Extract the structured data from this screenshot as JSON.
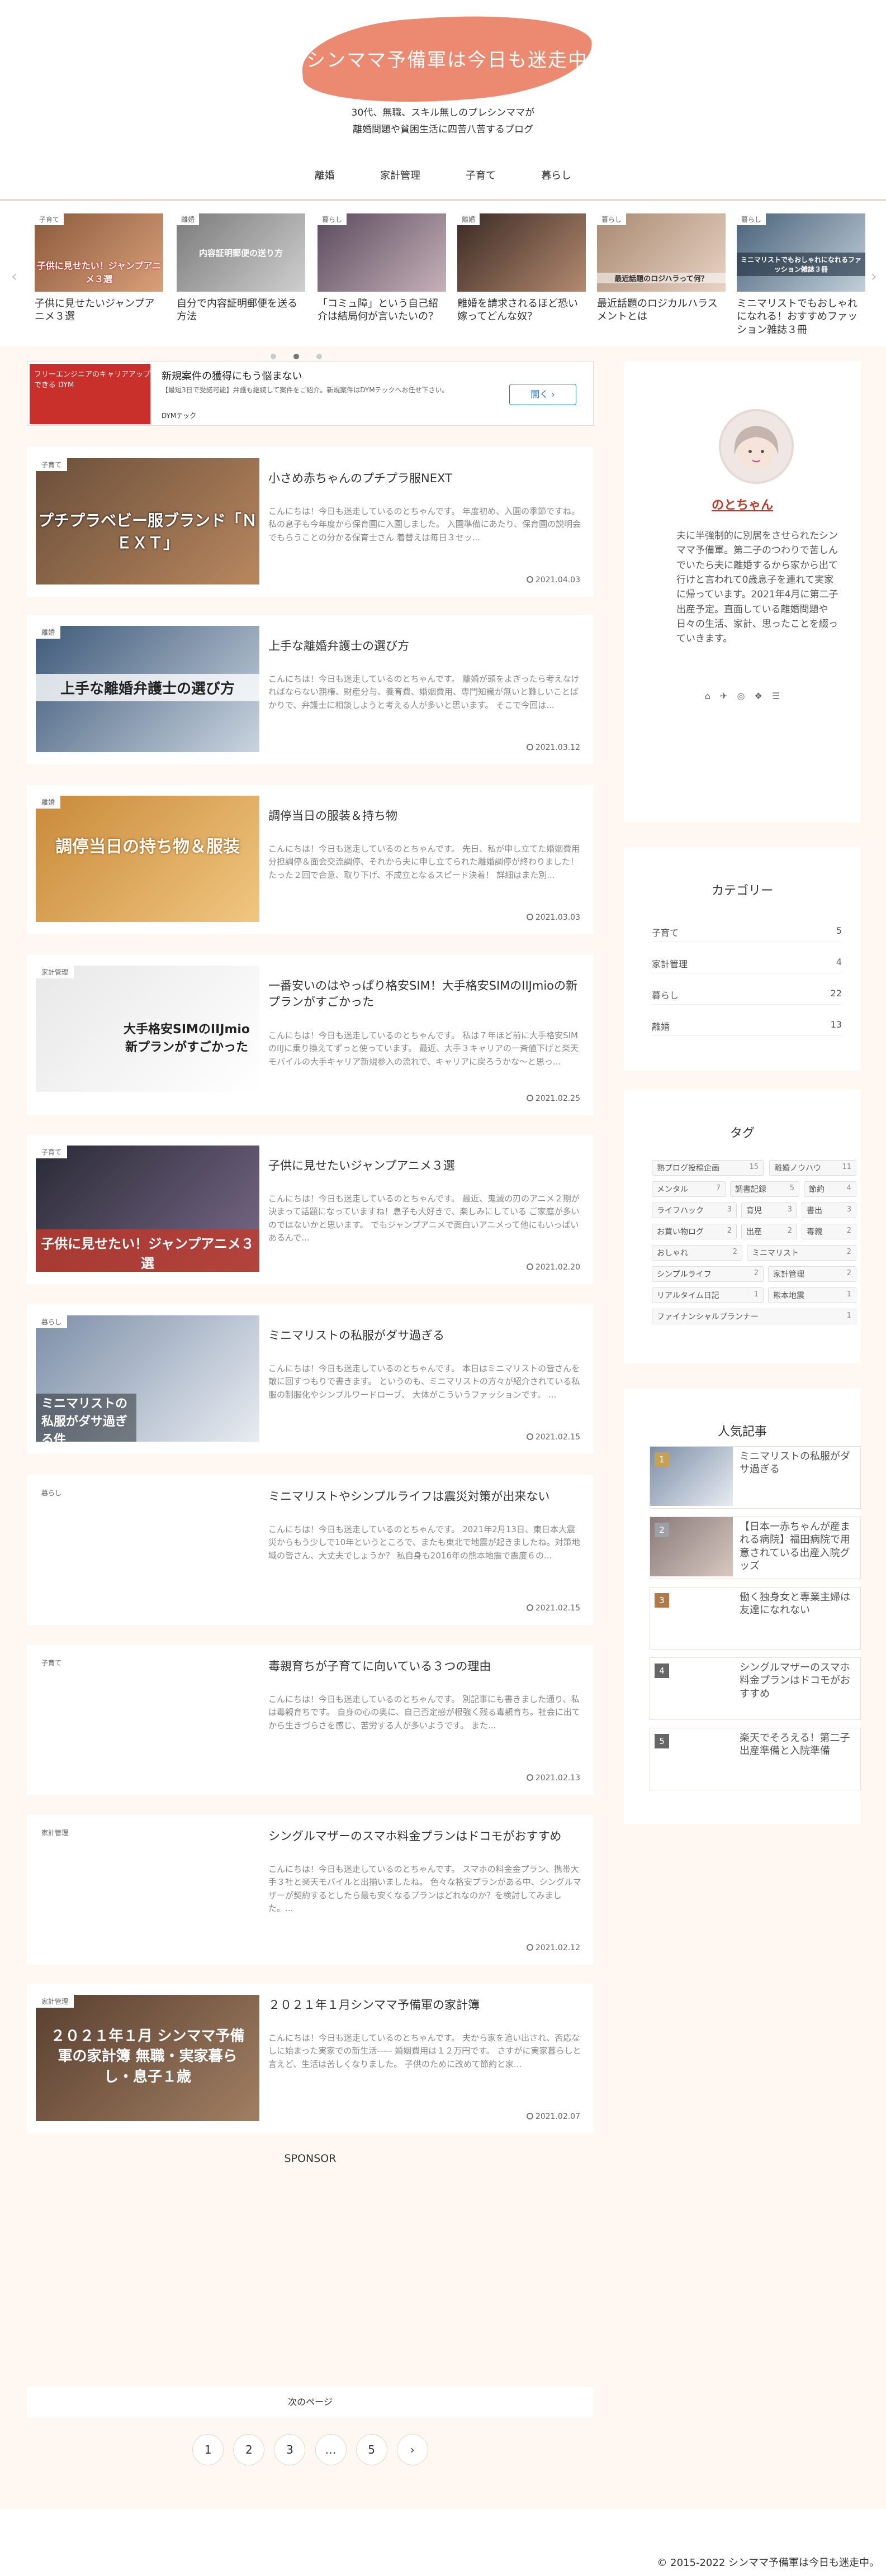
{
  "site": {
    "title": "シンママ予備軍は今日も迷走中",
    "tagline_1": "30代、無職、スキル無しのプレシンママが",
    "tagline_2": "離婚問題や貧困生活に四苦八苦するブログ"
  },
  "nav": [
    "離婚",
    "家計管理",
    "子育て",
    "暮らし"
  ],
  "carousel": [
    {
      "cat": "子育て",
      "title": "子供に見せたいジャンプアニメ３選",
      "thumb_text": "子供に見せたい！ジャンプアニメ３選"
    },
    {
      "cat": "離婚",
      "title": "自分で内容証明郵便を送る方法",
      "thumb_text": "内容証明郵便の送り方"
    },
    {
      "cat": "暮らし",
      "title": "「コミュ障」という自己紹介は結局何が言いたいの？",
      "thumb_text": ""
    },
    {
      "cat": "離婚",
      "title": "離婚を請求されるほど恐い嫁ってどんな奴？",
      "thumb_text": ""
    },
    {
      "cat": "暮らし",
      "title": "最近話題のロジカルハラスメントとは",
      "thumb_text": "最近話題のロジハラって何？"
    },
    {
      "cat": "暮らし",
      "title": "ミニマリストでもおしゃれになれる！おすすめファッション雑誌３冊",
      "thumb_text": "ミニマリストでもおしゃれになれるファッション雑誌３冊"
    }
  ],
  "ad": {
    "img_text": "フリーエンジニアのキャリアアップできる DYM",
    "title": "新規案件の獲得にもう悩まない",
    "desc": "【最短3日で受諾可能】弁護も継続して案件をご紹介。新規案件はDYMテックへお任せ下さい。",
    "source": "DYMテック",
    "button": "開く"
  },
  "posts": [
    {
      "cat": "子育て",
      "title": "小さめ赤ちゃんのプチプラ服NEXT",
      "excerpt": "こんにちは！今日も迷走しているのとちゃんです。 年度初め、入園の季節ですね。私の息子も今年度から保育園に入園しました。 入園準備にあたり、保育園の説明会でもらうことの分かる保育士さん 着替えは毎日３セッ...",
      "date": "2021.04.03",
      "thumb_text": "プチプラベビー服ブランド「ＮＥＸＴ」"
    },
    {
      "cat": "離婚",
      "title": "上手な離婚弁護士の選び方",
      "excerpt": "こんにちは！今日も迷走しているのとちゃんです。 離婚が頭をよぎったら考えなければならない親権、財産分与、養育費、婚姻費用、専門知識が無いと難しいことばかりで、弁護士に相談しようと考える人が多いと思います。 そこで今回は...",
      "date": "2021.03.12",
      "thumb_text": "上手な離婚弁護士の選び方"
    },
    {
      "cat": "離婚",
      "title": "調停当日の服装＆持ち物",
      "excerpt": "こんにちは！今日も迷走しているのとちゃんです。 先日、私が申し立てた婚姻費用分担調停＆面会交流調停、それから夫に申し立てられた離婚調停が終わりました！ たった２回で合意、取り下げ、不成立となるスピード決着！ 詳細はまた別...",
      "date": "2021.03.03",
      "thumb_text": "調停当日の持ち物＆服装"
    },
    {
      "cat": "家計管理",
      "title": "一番安いのはやっぱり格安SIM！大手格安SIMのIIJmioの新プランがすごかった",
      "excerpt": "こんにちは！今日も迷走しているのとちゃんです。 私は７年ほど前に大手格安SIMのIIJに乗り換えてずっと使っています。 最近、大手３キャリアの一斉値下げと楽天モバイルの大手キャリア新規参入の流れで、キャリアに戻ろうかな〜と思っ...",
      "date": "2021.02.25",
      "thumb_text": "大手格安SIMのIIJmio新プランがすごかった"
    },
    {
      "cat": "子育て",
      "title": "子供に見せたいジャンプアニメ３選",
      "excerpt": "こんにちは！今日も迷走しているのとちゃんです。 最近、鬼滅の刃のアニメ２期が決まって話題になっていますね！息子も大好きで、楽しみにしている ご家庭が多いのではないかと思います。 でもジャンプアニメで面白いアニメって他にもいっぱいあるんで...",
      "date": "2021.02.20",
      "thumb_text": "子供に見せたい！ジャンプアニメ３選"
    },
    {
      "cat": "暮らし",
      "title": "ミニマリストの私服がダサ過ぎる",
      "excerpt": "こんにちは！今日も迷走しているのとちゃんです。 本日はミニマリストの皆さんを敵に回すつもりで書きます。 というのも、ミニマリストの方々が紹介されている私服の制服化やシンプルワードローブ、 大体がこういうファッションです。 ...",
      "date": "2021.02.15",
      "thumb_text": "ミニマリストの私服がダサ過ぎる件"
    },
    {
      "cat": "暮らし",
      "title": "ミニマリストやシンプルライフは震災対策が出来ない",
      "excerpt": "こんにちは！今日も迷走しているのとちゃんです。 2021年2月13日、東日本大震災からもう少しで10年というところで、またも東北で地震が起きましたね。対策地域の皆さん、大丈夫でしょうか？ 私自身も2016年の熊本地震で震度６の...",
      "date": "2021.02.15",
      "thumb_text": ""
    },
    {
      "cat": "子育て",
      "title": "毒親育ちが子育てに向いている３つの理由",
      "excerpt": "こんにちは！今日も迷走しているのとちゃんです。 別記事にも書きました通り、私は毒親育ちです。 自身の心の奥に、自己否定感が根強く残る毒親育ち。社会に出てから生きづらさを感じ、苦労する人が多いようです。 また...",
      "date": "2021.02.13",
      "thumb_text": ""
    },
    {
      "cat": "家計管理",
      "title": "シングルマザーのスマホ料金プランはドコモがおすすめ",
      "excerpt": "こんにちは！今日も迷走しているのとちゃんです。 スマホの料金金プラン、携帯大手３社と楽天モバイルと出揃いましたね。 色々な格安プランがある中、シングルマザーが契約するとしたら最も安くなるプランはどれなのか？を検討してみました。...",
      "date": "2021.02.12",
      "thumb_text": ""
    },
    {
      "cat": "家計管理",
      "title": "２０２１年１月シンママ予備軍の家計簿",
      "excerpt": "こんにちは！今日も迷走しているのとちゃんです。 夫から家を追い出され、否応なしに始まった実家での新生活----- 婚姻費用は１２万円です。 さすがに実家暮らしと言えど、生活は苦しくなりました。 子供のために改めて節約と家...",
      "date": "2021.02.07",
      "thumb_text": "２０２１年１月 シンママ予備軍の家計簿 無職・実家暮らし・息子１歳"
    }
  ],
  "sponsor": "SPONSOR",
  "next_page": "次のページ",
  "pager": [
    "1",
    "2",
    "3",
    "…",
    "5",
    "›"
  ],
  "profile": {
    "name": "のとちゃん",
    "bio": "夫に半強制的に別居をさせられたシンママ予備軍。第二子のつわりで苦しんでいたら夫に離婚するから家から出て行けと言われて0歳息子を連れて実家に帰っています。2021年4月に第二子出産予定。直面している離婚問題や日々の生活、家計、思ったことを綴っていきます。",
    "social": [
      "⌂",
      "✈",
      "◎",
      "❖",
      "☰"
    ]
  },
  "categories": {
    "title": "カテゴリー",
    "items": [
      {
        "name": "子育て",
        "count": "5"
      },
      {
        "name": "家計管理",
        "count": "4"
      },
      {
        "name": "暮らし",
        "count": "22"
      },
      {
        "name": "離婚",
        "count": "13"
      }
    ]
  },
  "tags": {
    "title": "タグ",
    "items": [
      {
        "name": "熟プログ投稿企画",
        "count": "15"
      },
      {
        "name": "離婚ノウハウ",
        "count": "11"
      },
      {
        "name": "メンタル",
        "count": "7"
      },
      {
        "name": "調書記録",
        "count": "5"
      },
      {
        "name": "節約",
        "count": "4"
      },
      {
        "name": "ライフハック",
        "count": "3"
      },
      {
        "name": "育児",
        "count": "3"
      },
      {
        "name": "書出",
        "count": "3"
      },
      {
        "name": "お買い物ログ",
        "count": "2"
      },
      {
        "name": "出産",
        "count": "2"
      },
      {
        "name": "毒親",
        "count": "2"
      },
      {
        "name": "おしゃれ",
        "count": "2"
      },
      {
        "name": "ミニマリスト",
        "count": "2"
      },
      {
        "name": "シンプルライフ",
        "count": "2"
      },
      {
        "name": "家計管理",
        "count": "2"
      },
      {
        "name": "リアルタイム日記",
        "count": "1"
      },
      {
        "name": "熊本地震",
        "count": "1"
      },
      {
        "name": "ファイナンシャルプランナー",
        "count": "1"
      }
    ]
  },
  "popular": {
    "title": "人気記事",
    "items": [
      {
        "rank": "1",
        "title": "ミニマリストの私服がダサ過ぎる"
      },
      {
        "rank": "2",
        "title": "【日本一赤ちゃんが産まれる病院】福田病院で用意されている出産入院グッズ"
      },
      {
        "rank": "3",
        "title": "働く独身女と専業主婦は友達になれない"
      },
      {
        "rank": "4",
        "title": "シングルマザーのスマホ料金プランはドコモがおすすめ"
      },
      {
        "rank": "5",
        "title": "楽天でそろえる！第二子出産準備と入院準備"
      }
    ]
  },
  "footer": "© 2015-2022 シンママ予備軍は今日も迷走中。"
}
